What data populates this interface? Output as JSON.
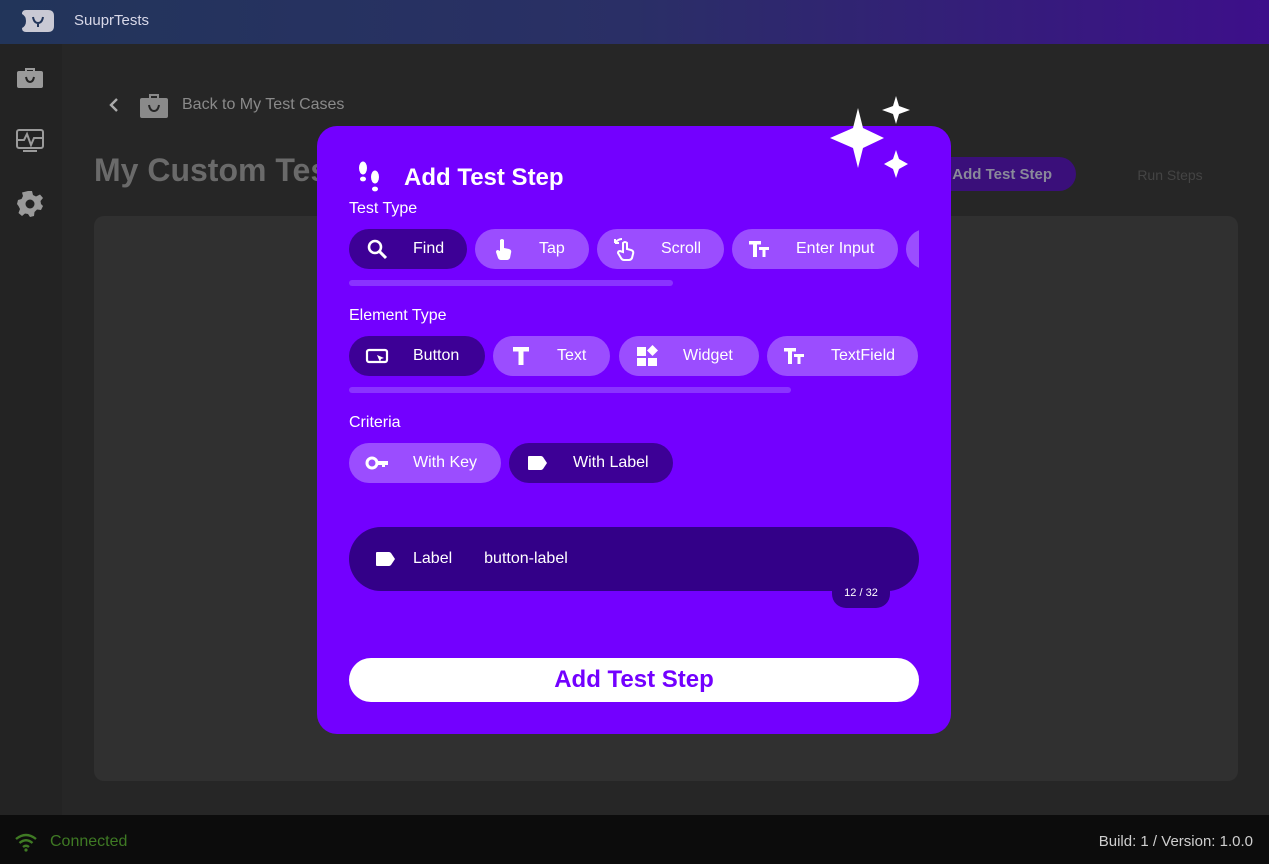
{
  "app": {
    "title": "SuuprTests"
  },
  "sidebar": {
    "items": [
      {
        "icon": "briefcase-icon"
      },
      {
        "icon": "monitor-heart-icon"
      },
      {
        "icon": "gear-icon"
      }
    ]
  },
  "main": {
    "back_label": "Back to My Test Cases",
    "page_title": "My Custom Test",
    "add_step_button": "Add Test Step",
    "run_button": "Run Steps"
  },
  "modal": {
    "title": "Add Test Step",
    "test_type": {
      "label": "Test Type",
      "options": [
        {
          "label": "Find",
          "icon": "search-icon",
          "selected": true
        },
        {
          "label": "Tap",
          "icon": "tap-icon",
          "selected": false
        },
        {
          "label": "Scroll",
          "icon": "swipe-icon",
          "selected": false
        },
        {
          "label": "Enter Input",
          "icon": "text-fields-icon",
          "selected": false
        }
      ]
    },
    "element_type": {
      "label": "Element Type",
      "options": [
        {
          "label": "Button",
          "icon": "button-icon",
          "selected": true
        },
        {
          "label": "Text",
          "icon": "text-icon",
          "selected": false
        },
        {
          "label": "Widget",
          "icon": "widgets-icon",
          "selected": false
        },
        {
          "label": "TextField",
          "icon": "text-fields-icon",
          "selected": false
        }
      ]
    },
    "criteria": {
      "label": "Criteria",
      "options": [
        {
          "label": "With Key",
          "icon": "key-icon",
          "selected": false
        },
        {
          "label": "With Label",
          "icon": "label-icon",
          "selected": true
        }
      ]
    },
    "label_field": {
      "label": "Label",
      "value": "button-label",
      "counter": "12 / 32"
    },
    "submit_label": "Add Test Step"
  },
  "status": {
    "connection": "Connected",
    "build": "Build: 1 / Version: 1.0.0"
  },
  "colors": {
    "modal": "#7300ff",
    "chip": "#9b4dff",
    "chip_selected": "#3d0096",
    "connected": "#3f7a24"
  }
}
